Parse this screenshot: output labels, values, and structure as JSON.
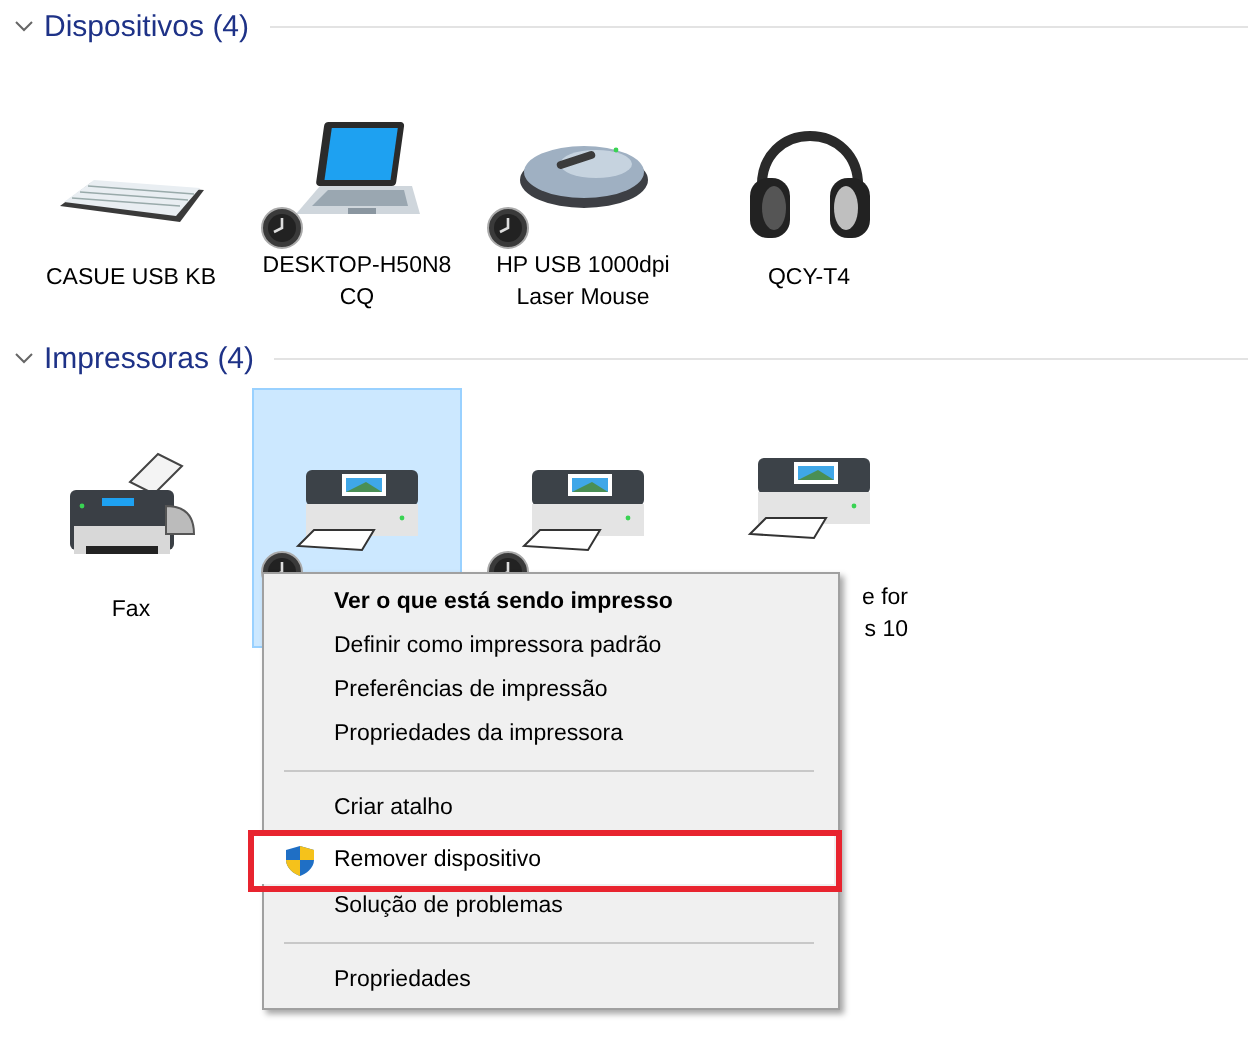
{
  "sections": [
    {
      "title": "Dispositivos (4)",
      "expanded": true,
      "items": [
        {
          "kind": "keyboard",
          "label": [
            "CASUE USB KB"
          ],
          "badge": false,
          "selected": false
        },
        {
          "kind": "laptop",
          "label": [
            "DESKTOP-H50N8",
            "CQ"
          ],
          "badge": true,
          "selected": false
        },
        {
          "kind": "mouse",
          "label": [
            "HP USB 1000dpi",
            "Laser Mouse"
          ],
          "badge": true,
          "selected": false
        },
        {
          "kind": "headphones",
          "label": [
            "QCY-T4"
          ],
          "badge": false,
          "selected": false
        }
      ]
    },
    {
      "title": "Impressoras (4)",
      "expanded": true,
      "items": [
        {
          "kind": "fax",
          "label": [
            "Fax"
          ],
          "badge": false,
          "selected": false
        },
        {
          "kind": "printer",
          "badge": true,
          "selected": true
        },
        {
          "kind": "printer",
          "badge": true,
          "selected": false
        },
        {
          "kind": "printer",
          "label": [
            "e for",
            "s 10"
          ],
          "badge": false,
          "selected": false
        }
      ]
    }
  ],
  "context_menu": {
    "items": [
      {
        "kind": "item",
        "label": "Ver o que está sendo impresso",
        "default": true,
        "hovered": false
      },
      {
        "kind": "item",
        "label": "Definir como impressora padrão",
        "default": false,
        "hovered": false
      },
      {
        "kind": "item",
        "label": "Preferências de impressão",
        "default": false,
        "hovered": false
      },
      {
        "kind": "item",
        "label": "Propriedades da impressora",
        "default": false,
        "hovered": false
      },
      {
        "kind": "separator"
      },
      {
        "kind": "item",
        "label": "Criar atalho",
        "default": false,
        "hovered": false
      },
      {
        "kind": "item",
        "label": "Remover dispositivo",
        "default": false,
        "hovered": true,
        "shield": true,
        "outlined": true
      },
      {
        "kind": "item",
        "label": "Solução de problemas",
        "default": false,
        "hovered": false
      },
      {
        "kind": "separator"
      },
      {
        "kind": "item",
        "label": "Propriedades",
        "default": false,
        "hovered": false
      }
    ]
  }
}
